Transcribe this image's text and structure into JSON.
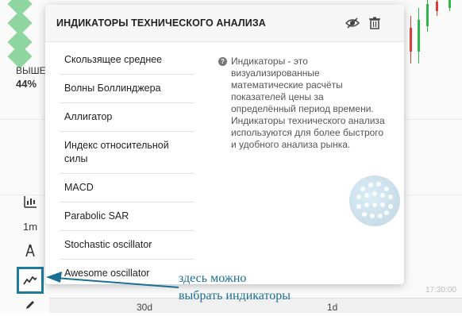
{
  "panel": {
    "title": "ИНДИКАТОРЫ ТЕХНИЧЕСКОГО АНАЛИЗА",
    "hide_icon": "eye-slash-icon",
    "delete_icon": "trash-icon",
    "indicators": [
      "Скользящее среднее",
      "Волны Боллинджера",
      "Аллигатор",
      "Индекс относительной силы",
      "MACD",
      "Parabolic SAR",
      "Stochastic oscillator",
      "Awesome oscillator"
    ],
    "info_icon": "question-circle-icon",
    "info_text": "Индикаторы - это визуализированные математические расчёты показателей цены за определённый период времени. Индикаторы технического анализа используются для более быстрого и удобного анализа рынка."
  },
  "left": {
    "label_higher": "ВЫШЕ",
    "percent": "44%"
  },
  "toolbar": {
    "chart_type_icon": "chart-candles-icon",
    "timeframe": "1m",
    "drawing_icon": "compass-icon",
    "indicators_icon": "indicators-wave-icon",
    "pencil_icon": "pencil-icon"
  },
  "axis": {
    "left_period": "30d",
    "right_period": "1d",
    "time_right": "17:30:00"
  },
  "annotation": {
    "line1": "здесь можно",
    "line2": "выбрать индикаторы"
  },
  "colors": {
    "accent": "#1e7b99",
    "callout": "#1a6f92",
    "green": "#8fd59f",
    "candle_green": "#2eb84a",
    "candle_red": "#e23b3b"
  }
}
